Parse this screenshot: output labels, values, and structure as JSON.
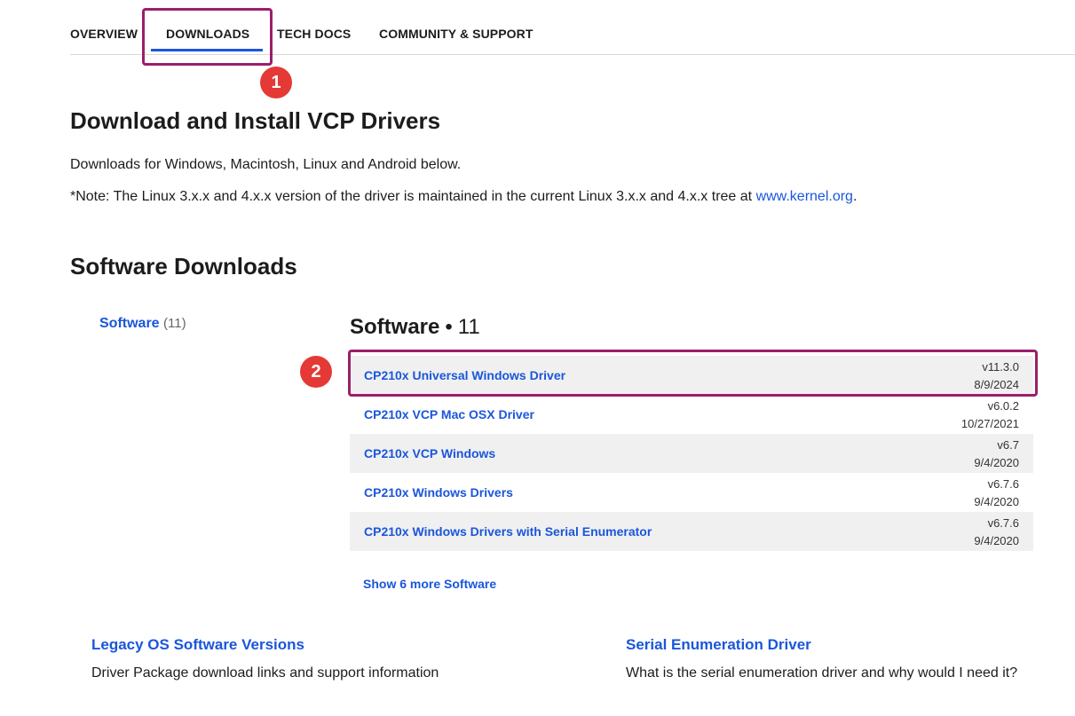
{
  "nav": {
    "tabs": [
      {
        "label": "OVERVIEW"
      },
      {
        "label": "DOWNLOADS"
      },
      {
        "label": "TECH DOCS"
      },
      {
        "label": "COMMUNITY & SUPPORT"
      }
    ],
    "active_tab": "DOWNLOADS"
  },
  "annotations": {
    "badge_1": "1",
    "badge_2": "2",
    "highlight_color": "#9a1f6a",
    "badge_color": "#e53935"
  },
  "main": {
    "title": "Download and Install VCP Drivers",
    "intro": "Downloads for Windows, Macintosh, Linux and Android below.",
    "note_prefix": "*Note: The Linux 3.x.x and 4.x.x version of the driver is maintained in the current Linux 3.x.x and 4.x.x tree at ",
    "note_link": "www.kernel.org",
    "note_suffix": ".",
    "section_title": "Software Downloads"
  },
  "filters": {
    "label": "Software",
    "count": "(11)"
  },
  "software_list": {
    "title": "Software",
    "separator": "•",
    "count": "11",
    "items": [
      {
        "name": "CP210x Universal Windows Driver",
        "version": "v11.3.0",
        "date": "8/9/2024"
      },
      {
        "name": "CP210x VCP Mac OSX Driver",
        "version": "v6.0.2",
        "date": "10/27/2021"
      },
      {
        "name": "CP210x VCP Windows",
        "version": "v6.7",
        "date": "9/4/2020"
      },
      {
        "name": "CP210x Windows Drivers",
        "version": "v6.7.6",
        "date": "9/4/2020"
      },
      {
        "name": "CP210x Windows Drivers with Serial Enumerator",
        "version": "v6.7.6",
        "date": "9/4/2020"
      }
    ],
    "show_more": "Show 6 more Software"
  },
  "cards": [
    {
      "title": "Legacy OS Software Versions",
      "description": "Driver Package download links and support information"
    },
    {
      "title": "Serial Enumeration Driver",
      "description": "What is the serial enumeration driver and why would I need it?"
    }
  ],
  "colors": {
    "link": "#1a56db",
    "tab_underline": "#1a56db",
    "row_shade": "#f0f0f0"
  }
}
